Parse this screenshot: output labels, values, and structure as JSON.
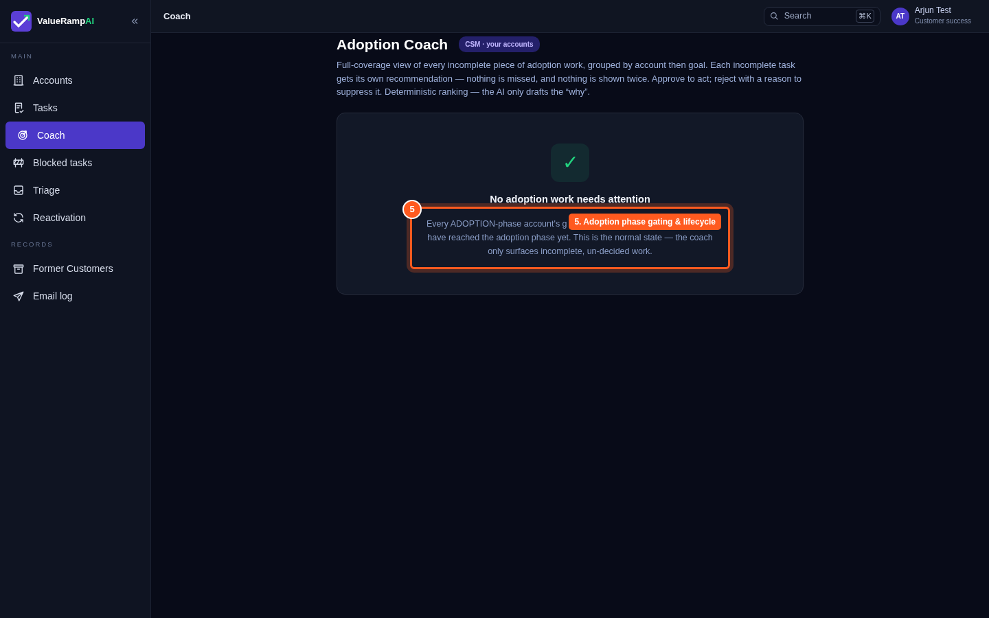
{
  "sidebar": {
    "brand": {
      "name": "ValueRamp",
      "suffix": "AI"
    },
    "sections": [
      {
        "heading": "MAIN",
        "items": [
          {
            "label": "Accounts",
            "selected": false
          },
          {
            "label": "Tasks",
            "selected": false
          },
          {
            "label": "Coach",
            "selected": true
          },
          {
            "label": "Blocked tasks",
            "selected": false
          },
          {
            "label": "Triage",
            "selected": false
          },
          {
            "label": "Reactivation",
            "selected": false
          }
        ]
      },
      {
        "heading": "RECORDS",
        "items": [
          {
            "label": "Former Customers",
            "selected": false
          },
          {
            "label": "Email log",
            "selected": false
          }
        ]
      }
    ]
  },
  "header": {
    "title": "Coach",
    "search": {
      "placeholder": "Search",
      "shortcut": "⌘K"
    },
    "user": {
      "initials": "AT",
      "name": "Arjun Test",
      "role": "Customer success"
    }
  },
  "page": {
    "title": "Adoption Coach",
    "badge": "CSM · your accounts",
    "description": "Full-coverage view of every incomplete piece of adoption work, grouped by account then goal. Each incomplete task gets its own recommendation — nothing is missed, and nothing is shown twice. Approve to act; reject with a reason to suppress it. Deterministic ranking — the AI only drafts the “why”.",
    "empty_state": {
      "icon": "✓",
      "title": "No adoption work needs attention",
      "lines": [
        "Every ADOPTION-phase account's g",
        "have reached the adoption phase yet. This is the normal state — the coach",
        "only surfaces incomplete, un-decided work."
      ]
    }
  },
  "annotation": {
    "number": "5",
    "label": "5. Adoption phase gating & lifecycle"
  }
}
